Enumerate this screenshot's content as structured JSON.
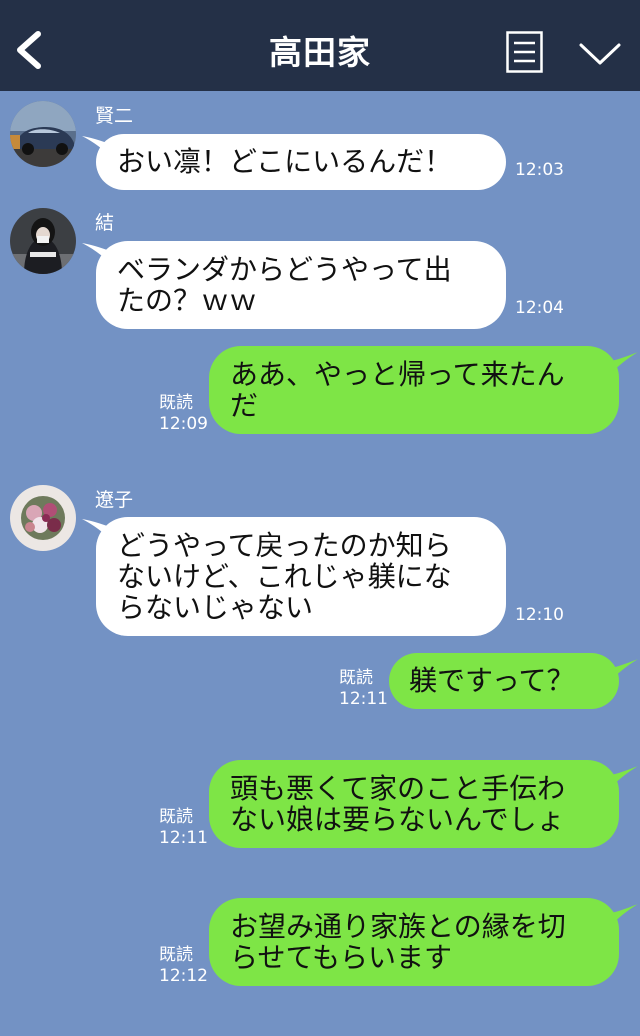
{
  "header": {
    "title": "高田家"
  },
  "colors": {
    "header_bg": "#243047",
    "chat_bg": "#7392c4",
    "incoming_bubble": "#ffffff",
    "outgoing_bubble": "#7ee546"
  },
  "icons": {
    "back": "chevron-left-icon",
    "menu": "menu-icon",
    "dropdown": "chevron-down-icon"
  },
  "messages": [
    {
      "sender": "賢二",
      "text": "おい凛！どこにいるんだ！",
      "time": "12:03"
    },
    {
      "sender": "結",
      "lines": [
        "ベランダからどうやって出",
        "たの？ｗｗ"
      ],
      "time": "12:04"
    },
    {
      "read": "既読",
      "lines": [
        "ああ、やっと帰って来たん",
        "だ"
      ],
      "time": "12:09"
    },
    {
      "sender": "遼子",
      "lines": [
        "どうやって戻ったのか知ら",
        "ないけど、これじゃ躾にな",
        "らないじゃない"
      ],
      "time": "12:10"
    },
    {
      "read": "既読",
      "text": "躾ですって？",
      "time": "12:11"
    },
    {
      "read": "既読",
      "lines": [
        "頭も悪くて家のこと手伝わ",
        "ない娘は要らないんでしょ"
      ],
      "time": "12:11"
    },
    {
      "read": "既読",
      "lines": [
        "お望み通り家族との縁を切",
        "らせてもらいます"
      ],
      "time": "12:12"
    }
  ]
}
